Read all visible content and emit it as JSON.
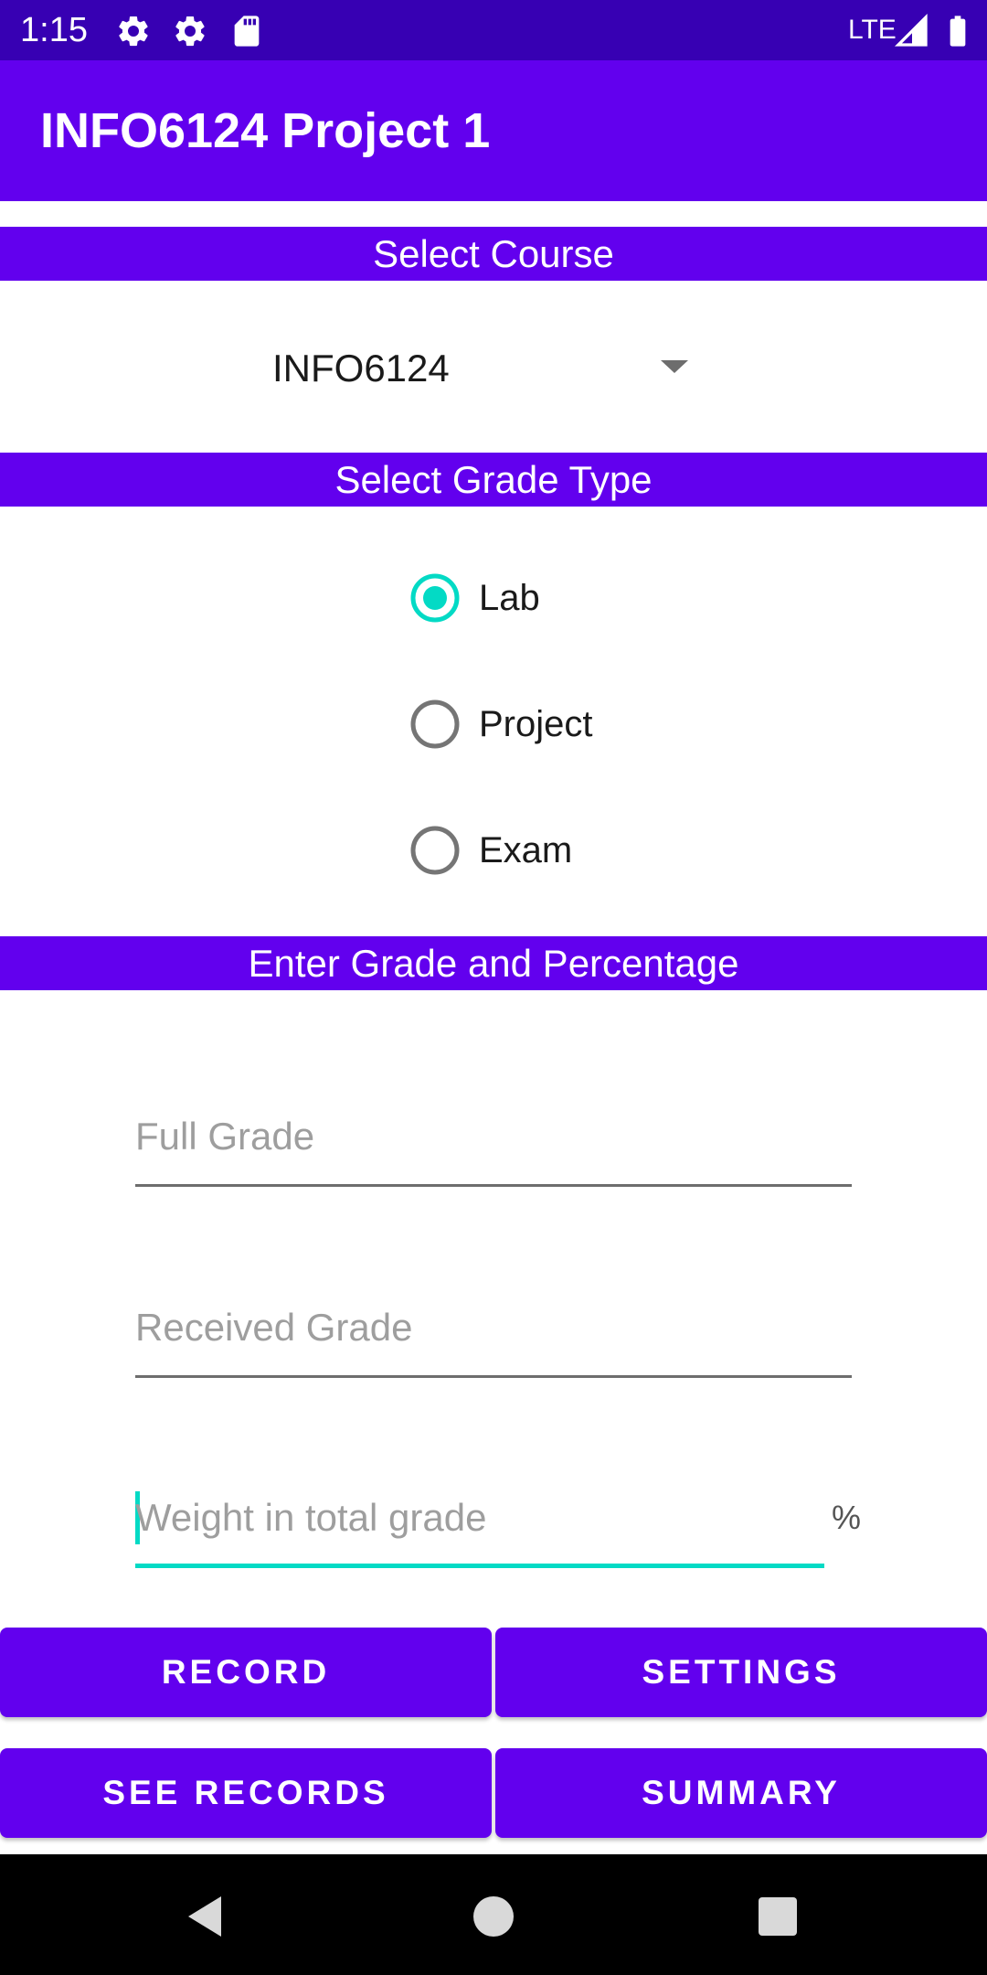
{
  "status_bar": {
    "time": "1:15",
    "network": "LTE",
    "icons": [
      "gear-icon",
      "gear-icon",
      "sd-card-icon",
      "signal-icon",
      "battery-icon"
    ]
  },
  "app_bar": {
    "title": "INFO6124 Project 1"
  },
  "sections": {
    "course": "Select Course",
    "grade_type": "Select Grade Type",
    "grade_entry": "Enter Grade and Percentage"
  },
  "course_spinner": {
    "selected": "INFO6124"
  },
  "grade_types": [
    {
      "label": "Lab",
      "checked": true
    },
    {
      "label": "Project",
      "checked": false
    },
    {
      "label": "Exam",
      "checked": false
    }
  ],
  "fields": {
    "full_grade": {
      "placeholder": "Full Grade",
      "value": ""
    },
    "received_grade": {
      "placeholder": "Received Grade",
      "value": ""
    },
    "weight": {
      "placeholder": "Weight in total grade",
      "value": "",
      "suffix": "%"
    }
  },
  "buttons": {
    "record": "RECORD",
    "settings": "SETTINGS",
    "see_records": "SEE RECORDS",
    "summary": "SUMMARY"
  },
  "colors": {
    "primary": "#6200ee",
    "primary_dark": "#3700b3",
    "accent": "#03dac5"
  }
}
